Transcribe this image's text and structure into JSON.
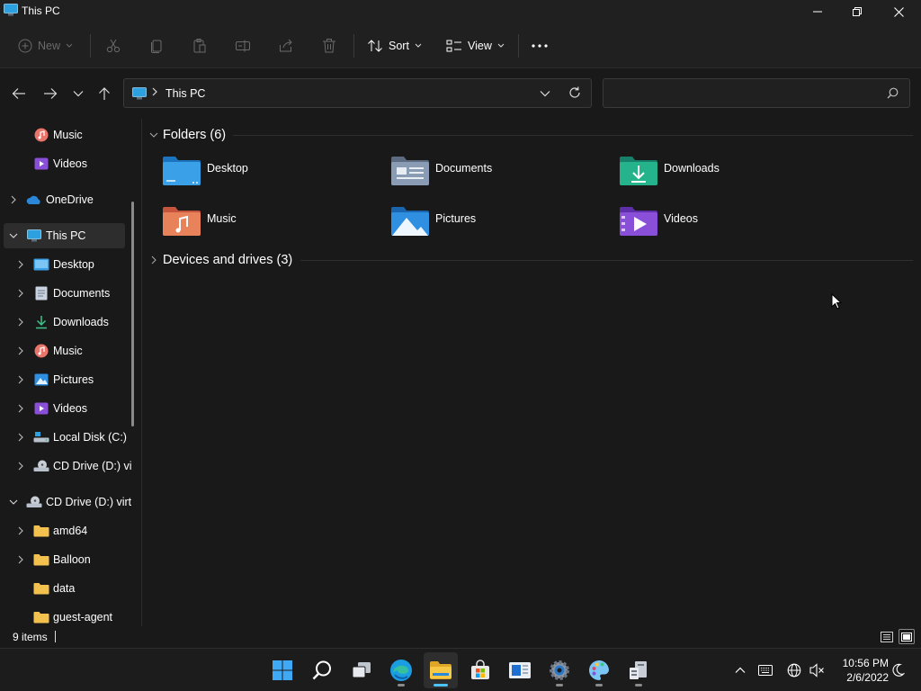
{
  "window": {
    "title": "This PC"
  },
  "toolbar": {
    "new_label": "New",
    "sort_label": "Sort",
    "view_label": "View"
  },
  "address": {
    "breadcrumb": "This PC",
    "search_value": ""
  },
  "sidebar": {
    "items": [
      {
        "label": "Music",
        "icon": "music-icon"
      },
      {
        "label": "Videos",
        "icon": "videos-icon"
      },
      {
        "label": "OneDrive",
        "icon": "onedrive-icon",
        "expandable": true
      },
      {
        "label": "This PC",
        "icon": "pc-icon",
        "expanded": true,
        "selected": true
      },
      {
        "label": "Desktop",
        "icon": "desktop-folder-icon"
      },
      {
        "label": "Documents",
        "icon": "documents-icon"
      },
      {
        "label": "Downloads",
        "icon": "downloads-icon"
      },
      {
        "label": "Music",
        "icon": "music-icon"
      },
      {
        "label": "Pictures",
        "icon": "pictures-icon"
      },
      {
        "label": "Videos",
        "icon": "videos-icon"
      },
      {
        "label": "Local Disk (C:)",
        "icon": "local-disk-icon"
      },
      {
        "label": "CD Drive (D:) vi",
        "icon": "cd-drive-icon"
      },
      {
        "label": "CD Drive (D:) virt",
        "icon": "cd-drive-icon",
        "expanded": true
      },
      {
        "label": "amd64",
        "icon": "folder-icon"
      },
      {
        "label": "Balloon",
        "icon": "folder-icon"
      },
      {
        "label": "data",
        "icon": "folder-icon"
      },
      {
        "label": "guest-agent",
        "icon": "folder-icon"
      }
    ]
  },
  "content": {
    "folders_group": "Folders (6)",
    "drives_group": "Devices and drives (3)",
    "folders": [
      {
        "name": "Desktop",
        "icon": "desktop-folder-icon",
        "color": "#3aa0e8"
      },
      {
        "name": "Documents",
        "icon": "documents-folder-icon",
        "color": "#8a9bb4"
      },
      {
        "name": "Downloads",
        "icon": "downloads-folder-icon",
        "color": "#24b38a"
      },
      {
        "name": "Music",
        "icon": "music-folder-icon",
        "color": "#e8825a"
      },
      {
        "name": "Pictures",
        "icon": "pictures-folder-icon",
        "color": "#2f8fe0"
      },
      {
        "name": "Videos",
        "icon": "videos-folder-icon",
        "color": "#8a4fd8"
      }
    ]
  },
  "status": {
    "item_count": "9 items"
  },
  "taskbar": {
    "apps": [
      "start-icon",
      "search-icon",
      "task-view-icon",
      "edge-icon",
      "file-explorer-icon",
      "store-icon",
      "news-icon",
      "settings-icon",
      "paint-icon",
      "server-icon"
    ],
    "time": "10:56 PM",
    "date": "2/6/2022"
  },
  "colors": {
    "background": "#191919",
    "chrome": "#202020",
    "accent": "#4cc2ff",
    "text": "#ffffff",
    "disabled": "#6a6a6a"
  }
}
